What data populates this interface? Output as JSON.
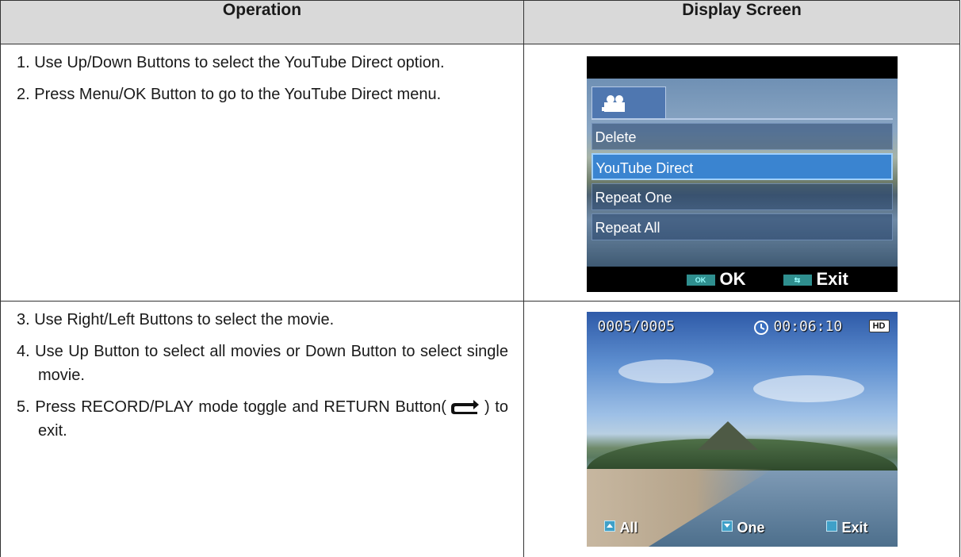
{
  "table": {
    "headers": {
      "operation": "Operation",
      "display": "Display Screen"
    },
    "row1_steps": [
      "1. Use Up/Down Buttons to select the YouTube Direct option.",
      "2. Press Menu/OK Button to go to the YouTube Direct menu."
    ],
    "row2_steps": {
      "s3": "3. Use Right/Left Buttons to select the movie.",
      "s4": "4. Use Up Button to select all movies or Down Button to select single movie.",
      "s5_before": "5. Press RECORD/PLAY mode toggle and RETURN Button(",
      "s5_icon": "return-button-icon",
      "s5_after": ") to exit."
    }
  },
  "screen1": {
    "tab_icon": "movie-camera-icon",
    "menu_items": [
      "Delete",
      "YouTube Direct",
      "Repeat One",
      "Repeat All"
    ],
    "selected_index": 1,
    "footer": {
      "ok_key": "OK",
      "ok_label": "OK",
      "exit_label": "Exit",
      "exit_icon": "return-icon"
    }
  },
  "screen2": {
    "counter": "0005/0005",
    "duration": "00:06:10",
    "duration_icon": "clock-icon",
    "quality_badge": "HD",
    "buttons": {
      "all": "All",
      "one": "One",
      "exit": "Exit"
    }
  }
}
